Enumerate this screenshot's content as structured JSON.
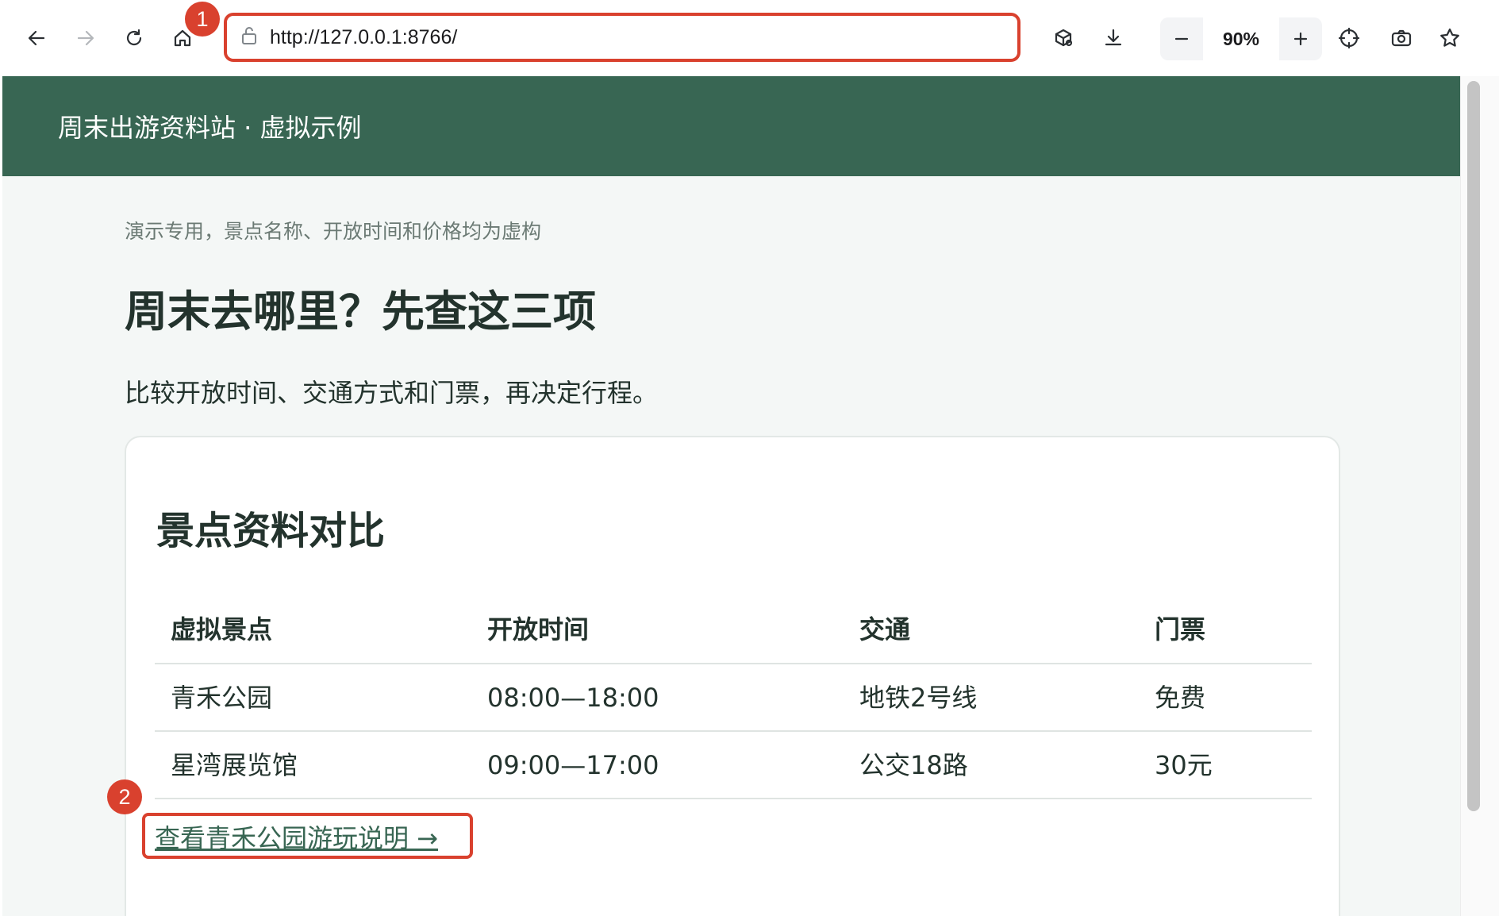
{
  "browser": {
    "url": "http://127.0.0.1:8766/",
    "zoom_level": "90%"
  },
  "annotations": {
    "badge_1": "1",
    "badge_2": "2"
  },
  "site": {
    "header_title": "周末出游资料站 · 虚拟示例"
  },
  "page": {
    "subnote": "演示专用，景点名称、开放时间和价格均为虚构",
    "title": "周末去哪里？先查这三项",
    "lead": "比较开放时间、交通方式和门票，再决定行程。"
  },
  "card": {
    "title": "景点资料对比",
    "table": {
      "headers": [
        "虚拟景点",
        "开放时间",
        "交通",
        "门票"
      ],
      "rows": [
        [
          "青禾公园",
          "08:00—18:00",
          "地铁2号线",
          "免费"
        ],
        [
          "星湾展览馆",
          "09:00—17:00",
          "公交18路",
          "30元"
        ]
      ]
    },
    "link_label": "查看青禾公园游玩说明 →"
  },
  "colors": {
    "header_bg": "#386653",
    "highlight": "#d9412e",
    "page_bg": "#f4f7f6"
  }
}
